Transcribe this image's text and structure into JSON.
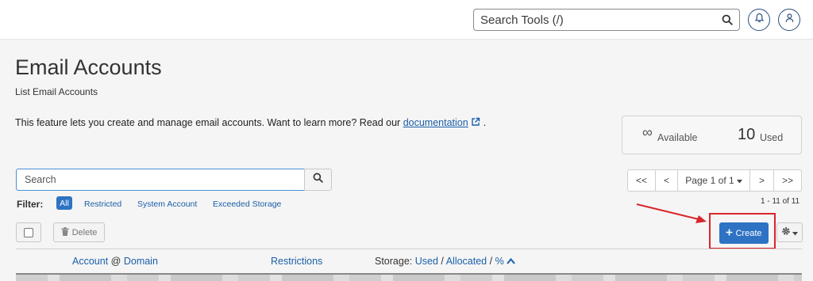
{
  "topbar": {
    "search_placeholder": "Search Tools (/)",
    "icons": [
      "search-icon",
      "bell-icon",
      "user-icon"
    ]
  },
  "page": {
    "title": "Email Accounts",
    "subtitle": "List Email Accounts",
    "description": "This feature lets you create and manage email accounts. Want to learn more? Read our",
    "doc_link": "documentation",
    "desc_end": "."
  },
  "stats": {
    "available_symbol": "∞",
    "available_label": "Available",
    "used_count": "10",
    "used_label": "Used"
  },
  "search": {
    "placeholder": "Search"
  },
  "filter": {
    "label": "Filter:",
    "options": [
      "All",
      "Restricted",
      "System Account",
      "Exceeded Storage"
    ],
    "active": "All"
  },
  "pagination": {
    "first": "<<",
    "prev": "<",
    "page_label": "Page 1 of 1",
    "next": ">",
    "last": ">>",
    "range": "1 - 11 of 11"
  },
  "toolbar": {
    "delete_label": "Delete",
    "create_label": "Create"
  },
  "table": {
    "col_account": "Account",
    "col_at": "@",
    "col_domain": "Domain",
    "col_restrictions": "Restrictions",
    "col_storage": "Storage:",
    "col_used": "Used",
    "col_slash1": "/",
    "col_allocated": "Allocated",
    "col_slash2": "/",
    "col_percent": "%"
  },
  "colors": {
    "primary": "#2e72c3",
    "link": "#1a5fa8",
    "annotation": "#d9262a"
  }
}
